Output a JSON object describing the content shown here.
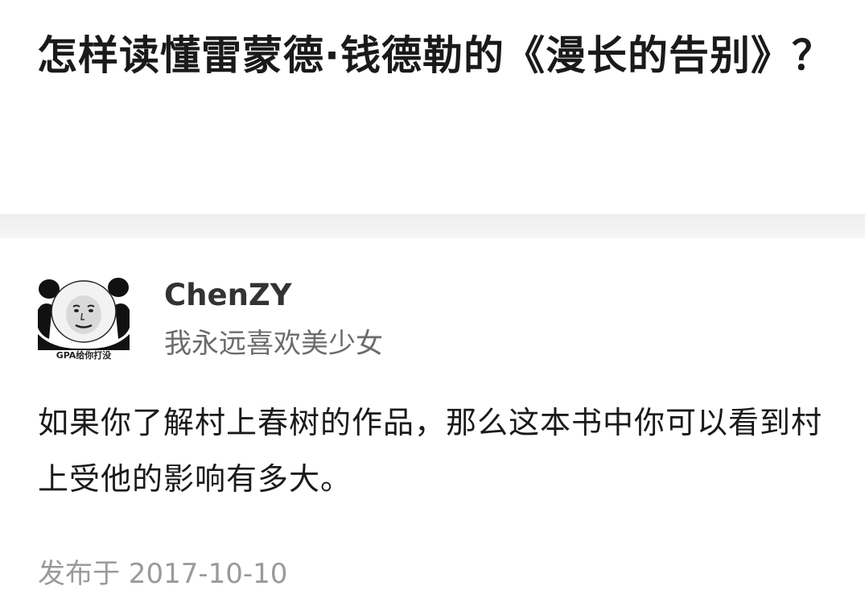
{
  "question": {
    "title": "怎样读懂雷蒙德·钱德勒的《漫长的告别》？"
  },
  "answer": {
    "author": {
      "name": "ChenZY",
      "bio": "我永远喜欢美少女",
      "avatar": {
        "icon": "panda-meme-avatar-icon",
        "caption": "GPA给你打没"
      }
    },
    "content": "如果你了解村上春树的作品，那么这本书中你可以看到村上受他的影响有多大。",
    "published": "发布于 2017-10-10"
  },
  "colors": {
    "title": "#1a1a1a",
    "author_name": "#333333",
    "bio": "#6b6b6b",
    "date": "#9a9a9a",
    "separator": "#eeeeee"
  }
}
